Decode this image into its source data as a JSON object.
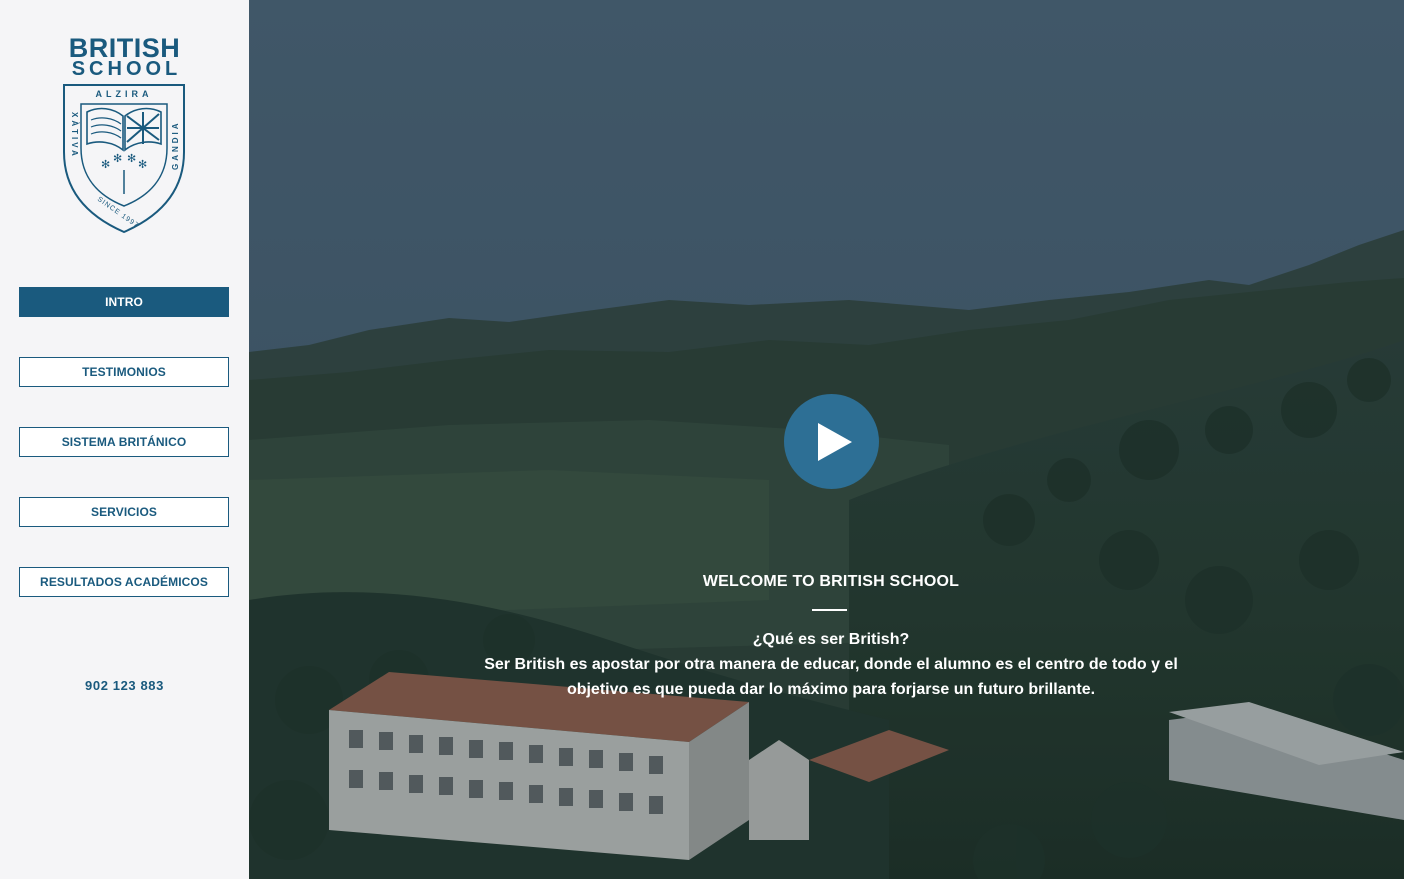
{
  "logo": {
    "line1": "BRITISH",
    "line2": "SCHOOL",
    "top_text": "ALZIRA",
    "left_text": "XÀTIVA",
    "right_text": "GANDIA",
    "bottom_text": "SINCE 1997"
  },
  "nav": {
    "items": [
      {
        "label": "INTRO",
        "active": true
      },
      {
        "label": "TESTIMONIOS",
        "active": false
      },
      {
        "label": "SISTEMA BRITÁNICO",
        "active": false
      },
      {
        "label": "SERVICIOS",
        "active": false
      },
      {
        "label": "RESULTADOS ACADÉMICOS",
        "active": false
      }
    ]
  },
  "contact": {
    "phone": "902 123 883"
  },
  "hero": {
    "heading": "WELCOME TO BRITISH SCHOOL",
    "question": "¿Qué es ser British?",
    "body": "Ser British es apostar por otra manera de educar, donde el alumno es el centro de todo y el objetivo es que pueda dar lo máximo para forjarse un futuro brillante.",
    "play_icon": "play-icon"
  },
  "colors": {
    "brand": "#1a5a7e",
    "play_button": "#2d6f95",
    "sidebar_bg": "#f5f5f7"
  }
}
